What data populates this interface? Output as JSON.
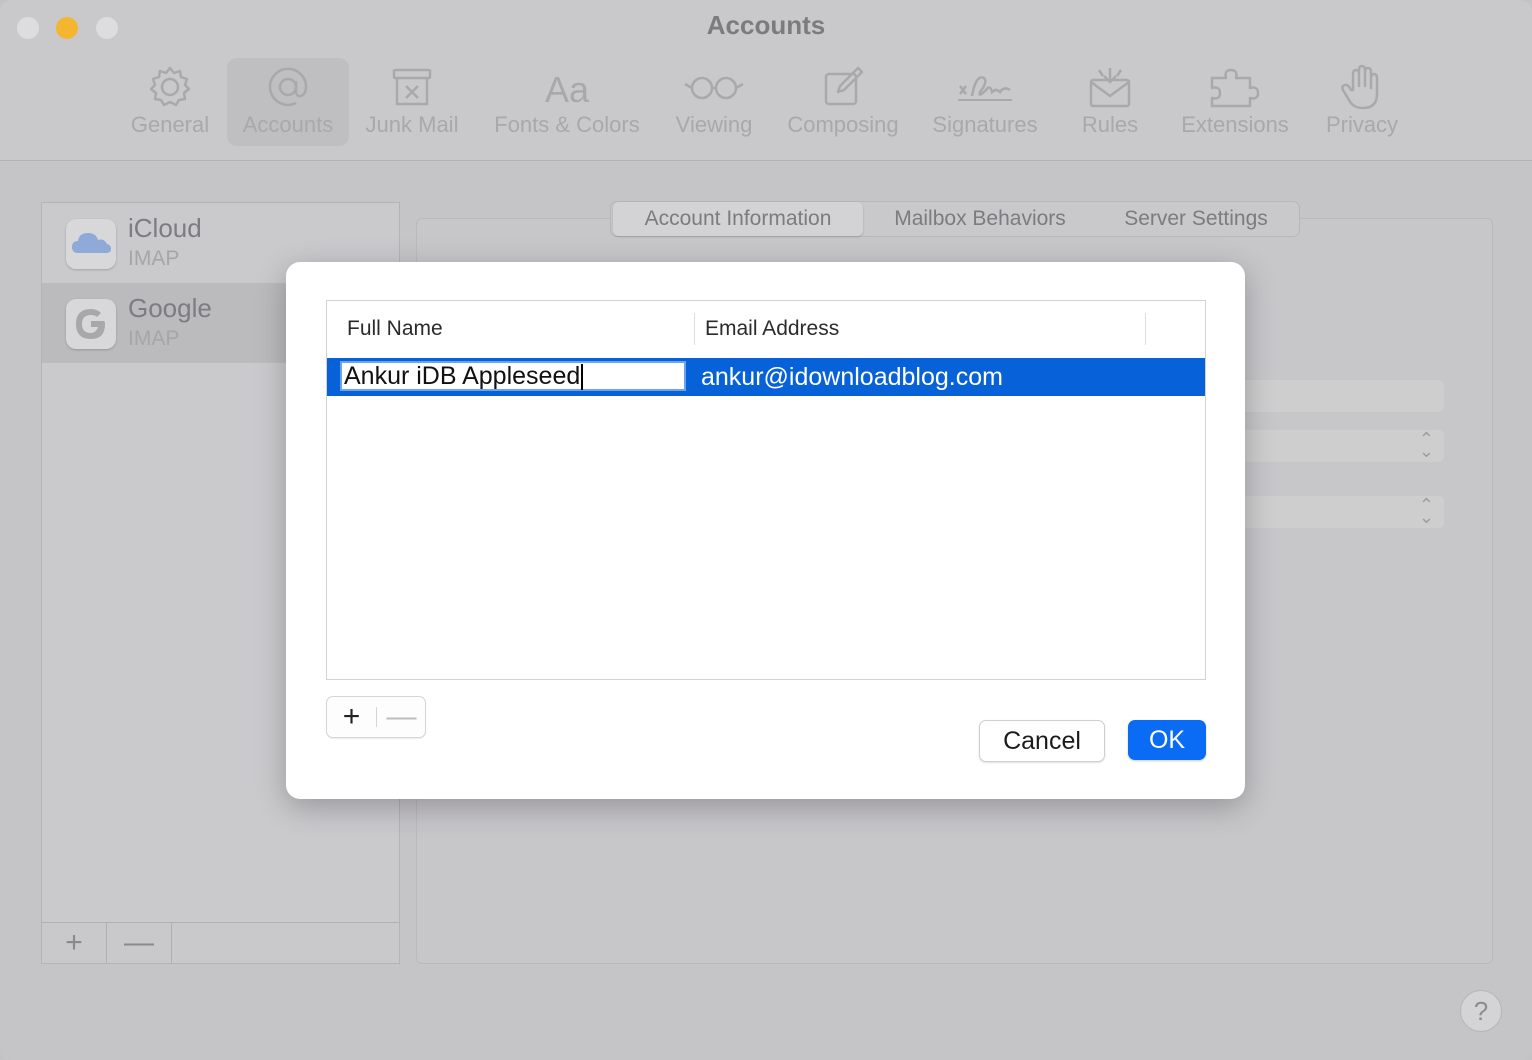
{
  "window": {
    "title": "Accounts"
  },
  "toolbar": [
    {
      "label": "General",
      "icon": "gear-icon"
    },
    {
      "label": "Accounts",
      "icon": "at-icon"
    },
    {
      "label": "Junk Mail",
      "icon": "junk-mail-icon"
    },
    {
      "label": "Fonts & Colors",
      "icon": "fonts-icon"
    },
    {
      "label": "Viewing",
      "icon": "glasses-icon"
    },
    {
      "label": "Composing",
      "icon": "compose-icon"
    },
    {
      "label": "Signatures",
      "icon": "signature-icon"
    },
    {
      "label": "Rules",
      "icon": "rules-icon"
    },
    {
      "label": "Extensions",
      "icon": "puzzle-icon"
    },
    {
      "label": "Privacy",
      "icon": "hand-icon"
    }
  ],
  "sidebar": {
    "accounts": [
      {
        "name": "iCloud",
        "type": "IMAP",
        "icon": "icloud-icon"
      },
      {
        "name": "Google",
        "type": "IMAP",
        "icon": "google-icon"
      }
    ],
    "add_label": "+",
    "remove_label": "—"
  },
  "tabs": [
    {
      "label": "Account Information",
      "active": true
    },
    {
      "label": "Mailbox Behaviors",
      "active": false
    },
    {
      "label": "Server Settings",
      "active": false
    }
  ],
  "dialog": {
    "columns": {
      "full_name": "Full Name",
      "email": "Email Address"
    },
    "row": {
      "full_name": "Ankur iDB Appleseed",
      "email": "ankur@idownloadblog.com"
    },
    "add_label": "+",
    "remove_label": "—",
    "cancel_label": "Cancel",
    "ok_label": "OK"
  },
  "help_label": "?",
  "colors": {
    "accent": "#0a6cf5",
    "selection": "#0762d9"
  }
}
